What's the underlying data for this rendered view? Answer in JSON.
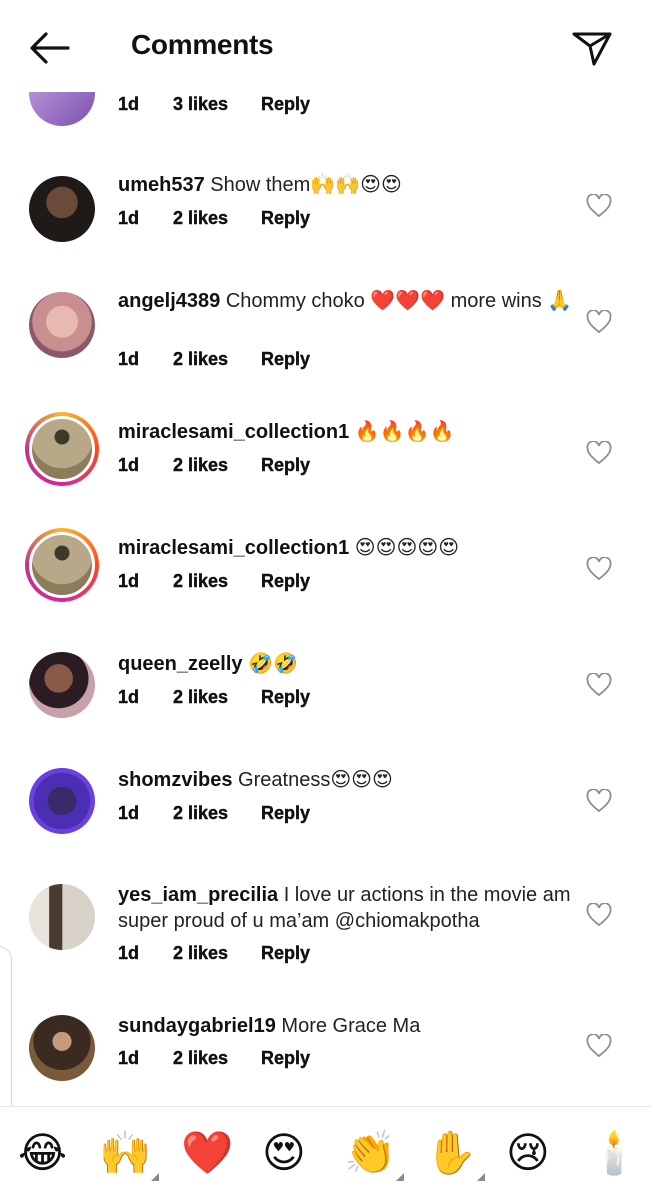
{
  "header": {
    "title": "Comments"
  },
  "partial_comment": {
    "age": "1d",
    "likes": "3 likes",
    "reply": "Reply"
  },
  "comments": [
    {
      "username": "umeh537",
      "text": "Show them🙌🙌😍😍",
      "age": "1d",
      "likes": "2 likes",
      "reply": "Reply"
    },
    {
      "username": "angelj4389",
      "text": "Chommy choko ❤️❤️❤️ more wins 🙏",
      "age": "1d",
      "likes": "2 likes",
      "reply": "Reply"
    },
    {
      "username": "miraclesami_collection1",
      "text": "🔥🔥🔥🔥",
      "age": "1d",
      "likes": "2 likes",
      "reply": "Reply"
    },
    {
      "username": "miraclesami_collection1",
      "text": "😍😍😍😍😍",
      "age": "1d",
      "likes": "2 likes",
      "reply": "Reply"
    },
    {
      "username": "queen_zeelly",
      "text": "🤣🤣",
      "age": "1d",
      "likes": "2 likes",
      "reply": "Reply"
    },
    {
      "username": "shomzvibes",
      "text": "Greatness😍😍😍",
      "age": "1d",
      "likes": "2 likes",
      "reply": "Reply"
    },
    {
      "username": "yes_iam_precilia",
      "text": "I love ur actions in the movie am super proud of u ma’am @chiomakpotha",
      "age": "1d",
      "likes": "2 likes",
      "reply": "Reply"
    },
    {
      "username": "sundaygabriel19",
      "text": "More Grace Ma",
      "age": "1d",
      "likes": "2 likes",
      "reply": "Reply"
    }
  ],
  "emoji_bar": [
    {
      "glyph": "😂",
      "icon": "tears-of-joy-emoji"
    },
    {
      "glyph": "🙌",
      "icon": "raising-hands-emoji"
    },
    {
      "glyph": "❤️",
      "icon": "red-heart-emoji"
    },
    {
      "glyph": "😍",
      "icon": "heart-eyes-emoji"
    },
    {
      "glyph": "👏",
      "icon": "clapping-hands-emoji"
    },
    {
      "glyph": "✋",
      "icon": "raised-hand-emoji"
    },
    {
      "glyph": "😢",
      "icon": "crying-face-emoji"
    },
    {
      "glyph": "🕯️",
      "icon": "candle-emoji"
    }
  ],
  "colors": {
    "ring_start": "#f7b733",
    "ring_end": "#c13584",
    "text": "#111111"
  }
}
